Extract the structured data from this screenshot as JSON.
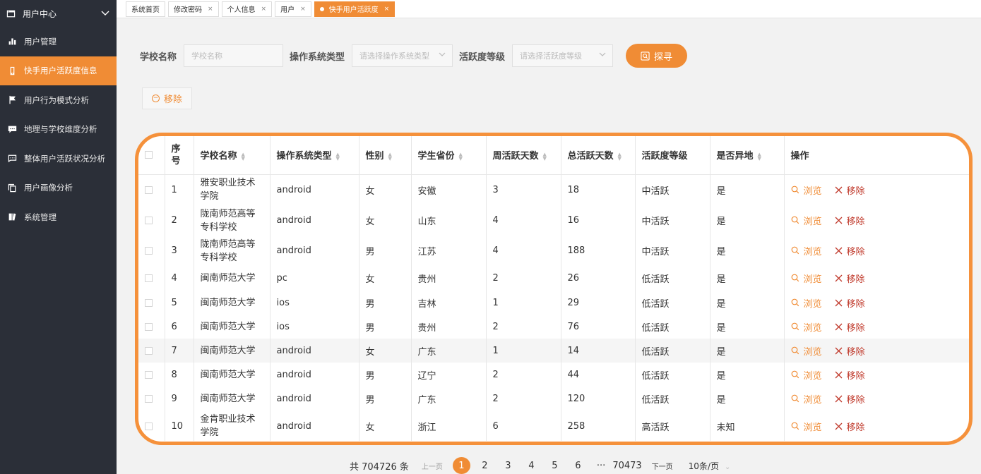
{
  "sidebar": {
    "header": {
      "icon": "window-icon",
      "label": "用户中心",
      "chevron": "chevron-down-icon"
    },
    "items": [
      {
        "icon": "bar-chart-icon",
        "label": "用户管理",
        "active": false
      },
      {
        "icon": "phone-icon",
        "label": "快手用户活跃度信息",
        "active": true
      },
      {
        "icon": "flag-icon",
        "label": "用户行为模式分析",
        "active": false
      },
      {
        "icon": "chat-icon",
        "label": "地理与学校维度分析",
        "active": false
      },
      {
        "icon": "message-dots-icon",
        "label": "整体用户活跃状况分析",
        "active": false
      },
      {
        "icon": "copy-icon",
        "label": "用户画像分析",
        "active": false
      },
      {
        "icon": "book-icon",
        "label": "系统管理",
        "active": false
      }
    ]
  },
  "tabs": [
    {
      "label": "系统首页",
      "closable": false,
      "active": false
    },
    {
      "label": "修改密码",
      "closable": true,
      "active": false
    },
    {
      "label": "个人信息",
      "closable": true,
      "active": false
    },
    {
      "label": "用户",
      "closable": true,
      "active": false
    },
    {
      "label": "快手用户活跃度",
      "closable": true,
      "active": true
    }
  ],
  "search": {
    "school_label": "学校名称",
    "school_placeholder": "学校名称",
    "os_label": "操作系统类型",
    "os_placeholder": "请选择操作系统类型",
    "level_label": "活跃度等级",
    "level_placeholder": "请选择活跃度等级",
    "button_label": "探寻"
  },
  "toolbar": {
    "remove_label": "移除"
  },
  "table": {
    "headers": [
      "序号",
      "学校名称",
      "操作系统类型",
      "性别",
      "学生省份",
      "周活跃天数",
      "总活跃天数",
      "活跃度等级",
      "是否异地",
      "操作"
    ],
    "view_label": "浏览",
    "delete_label": "移除",
    "rows": [
      [
        "1",
        "雅安职业技术学院",
        "android",
        "女",
        "安徽",
        "3",
        "18",
        "中活跃",
        "是"
      ],
      [
        "2",
        "陇南师范高等专科学校",
        "android",
        "女",
        "山东",
        "4",
        "16",
        "中活跃",
        "是"
      ],
      [
        "3",
        "陇南师范高等专科学校",
        "android",
        "男",
        "江苏",
        "4",
        "188",
        "中活跃",
        "是"
      ],
      [
        "4",
        "闽南师范大学",
        "pc",
        "女",
        "贵州",
        "2",
        "26",
        "低活跃",
        "是"
      ],
      [
        "5",
        "闽南师范大学",
        "ios",
        "男",
        "吉林",
        "1",
        "29",
        "低活跃",
        "是"
      ],
      [
        "6",
        "闽南师范大学",
        "ios",
        "男",
        "贵州",
        "2",
        "76",
        "低活跃",
        "是"
      ],
      [
        "7",
        "闽南师范大学",
        "android",
        "女",
        "广东",
        "1",
        "14",
        "低活跃",
        "是"
      ],
      [
        "8",
        "闽南师范大学",
        "android",
        "男",
        "辽宁",
        "2",
        "44",
        "低活跃",
        "是"
      ],
      [
        "9",
        "闽南师范大学",
        "android",
        "男",
        "广东",
        "2",
        "120",
        "低活跃",
        "是"
      ],
      [
        "10",
        "金肯职业技术学院",
        "android",
        "女",
        "浙江",
        "6",
        "258",
        "高活跃",
        "未知"
      ]
    ],
    "highlight_row": 7
  },
  "pagination": {
    "total": "共 704726 条",
    "prev": "上一页",
    "pages": [
      "1",
      "2",
      "3",
      "4",
      "5",
      "6"
    ],
    "current": "1",
    "ellipsis": "···",
    "last": "70473",
    "next": "下一页",
    "page_size": "10条/页"
  },
  "colors": {
    "accent": "#f08c35",
    "sidebar_bg": "#2b2f38",
    "danger": "#c0392b"
  }
}
